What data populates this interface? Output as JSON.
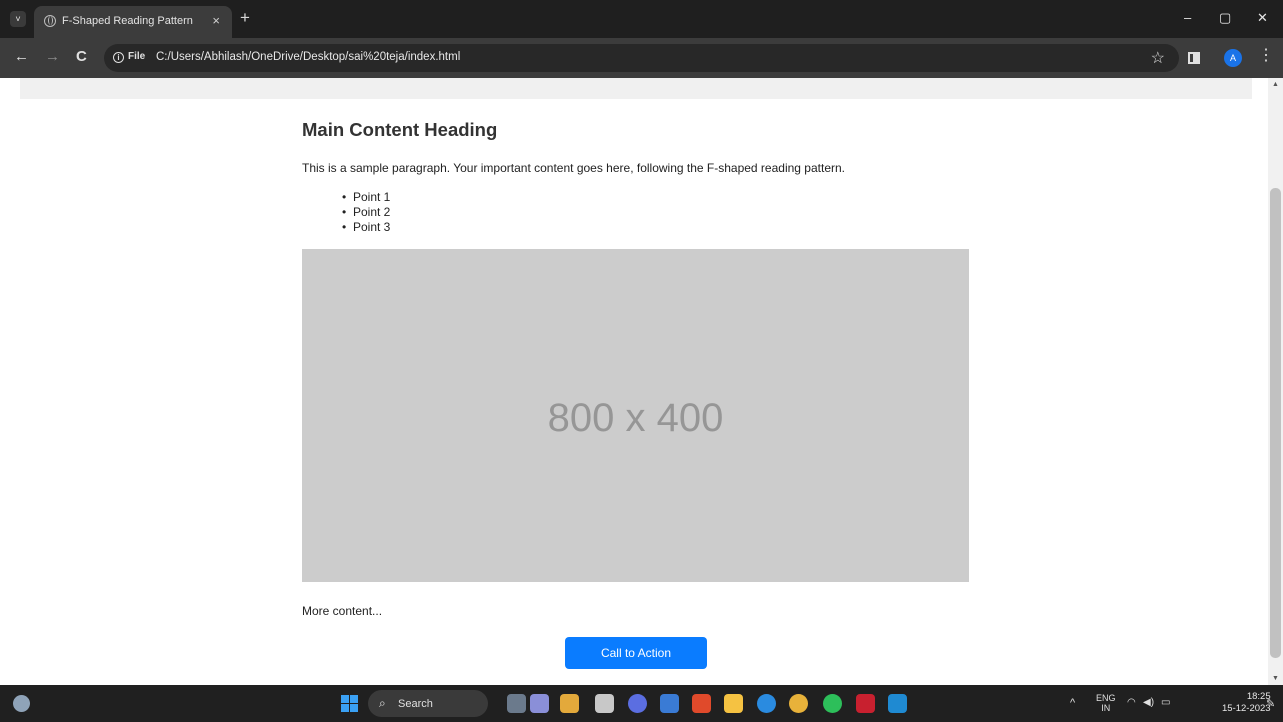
{
  "browser": {
    "tab_title": "F-Shaped Reading Pattern",
    "tab_close": "×",
    "new_tab": "+",
    "tab_menu": "˅",
    "url": "C:/Users/Abhilash/OneDrive/Desktop/sai%20teja/index.html",
    "file_chip": "File",
    "profile_initial": "A",
    "window_controls": {
      "minimize": "–",
      "maximize": "▢",
      "close": "✕"
    },
    "nav": {
      "back": "←",
      "forward": "→",
      "reload": "C"
    }
  },
  "page": {
    "heading": "Main Content Heading",
    "paragraph": "This is a sample paragraph. Your important content goes here, following the F-shaped reading pattern.",
    "points": [
      "Point 1",
      "Point 2",
      "Point 3"
    ],
    "image_placeholder": "800 x 400",
    "more": "More content...",
    "cta_label": "Call to Action",
    "cta_color": "#0a7cff"
  },
  "taskbar": {
    "search_label": "Search",
    "language": "ENG",
    "region": "IN",
    "time": "18:25",
    "date": "15-12-2023",
    "apps": [
      "file-manager-icon",
      "teams-icon",
      "notes-icon",
      "chat-icon",
      "store-icon",
      "brave-icon",
      "explorer-icon",
      "edge-icon",
      "chrome-icon",
      "whatsapp-icon",
      "mcafee-icon",
      "vscode-icon"
    ]
  }
}
